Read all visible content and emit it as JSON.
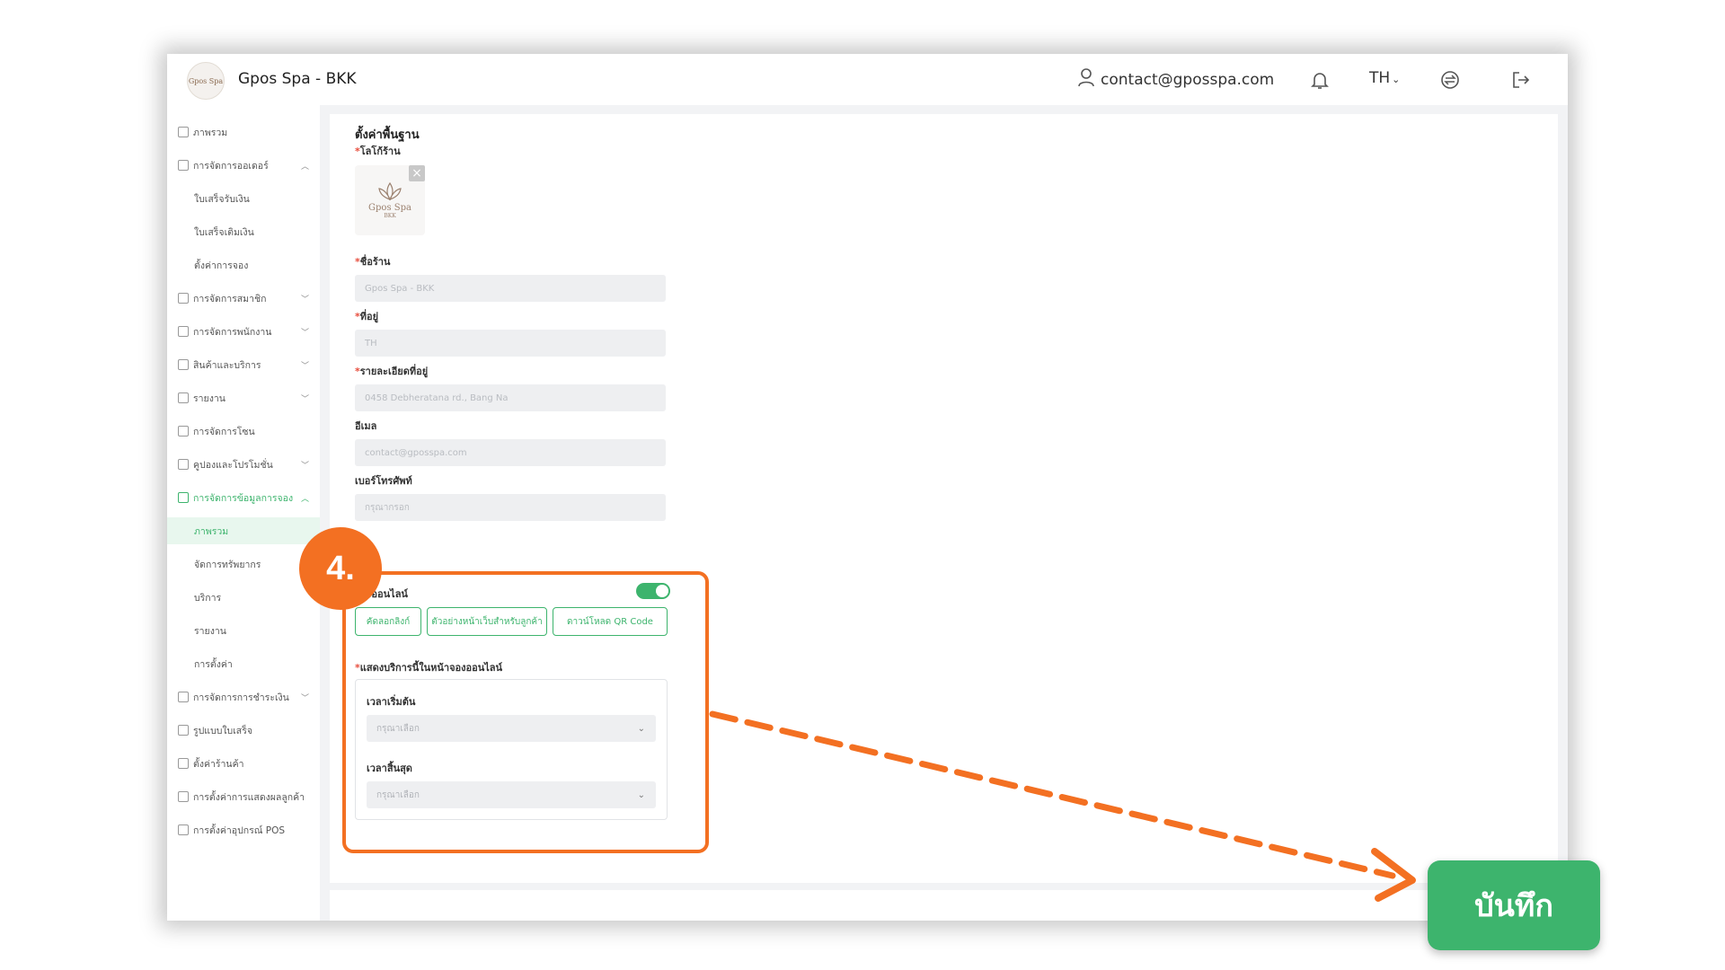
{
  "header": {
    "logo_text": "Gpos Spa",
    "brand": "Gpos Spa - BKK",
    "user_email": "contact@gposspa.com",
    "language": "TH",
    "icons": {
      "user": "user-icon",
      "bell": "bell-icon",
      "switch": "switch-icon",
      "logout": "logout-icon"
    }
  },
  "sidebar": {
    "items": [
      {
        "label": "ภาพรวม",
        "icon": "clipboard-icon",
        "chevron": ""
      },
      {
        "label": "การจัดการออเดอร์",
        "icon": "document-icon",
        "chevron": "up"
      },
      {
        "label": "ใบเสร็จรับเงิน",
        "sub": true
      },
      {
        "label": "ใบเสร็จเติมเงิน",
        "sub": true
      },
      {
        "label": "ตั้งค่าการจอง",
        "sub": true
      },
      {
        "label": "การจัดการสมาชิก",
        "icon": "crown-icon",
        "chevron": "down"
      },
      {
        "label": "การจัดการพนักงาน",
        "icon": "calendar-icon",
        "chevron": "down"
      },
      {
        "label": "สินค้าและบริการ",
        "icon": "product-icon",
        "chevron": "down"
      },
      {
        "label": "รายงาน",
        "icon": "report-icon",
        "chevron": "down"
      },
      {
        "label": "การจัดการโซน",
        "icon": "zone-icon",
        "chevron": ""
      },
      {
        "label": "คูปองและโปรโมชั่น",
        "icon": "gift-icon",
        "chevron": "down"
      },
      {
        "label": "การจัดการข้อมูลการจอง",
        "icon": "booking-icon",
        "chevron": "up",
        "active_parent": true
      },
      {
        "label": "ภาพรวม",
        "sub": true,
        "active": true
      },
      {
        "label": "จัดการทรัพยากร",
        "sub": true,
        "chevron": "down"
      },
      {
        "label": "บริการ",
        "sub": true
      },
      {
        "label": "รายงาน",
        "sub": true,
        "chevron": "down"
      },
      {
        "label": "การตั้งค่า",
        "sub": true,
        "chevron": "down"
      },
      {
        "label": "การจัดการการชำระเงิน",
        "icon": "payment-icon",
        "chevron": "down"
      },
      {
        "label": "รูปแบบใบเสร็จ",
        "icon": "receipt-icon",
        "chevron": ""
      },
      {
        "label": "ตั้งค่าร้านค้า",
        "icon": "store-icon",
        "chevron": ""
      },
      {
        "label": "การตั้งค่าการแสดงผลลูกค้า",
        "icon": "display-icon",
        "chevron": ""
      },
      {
        "label": "การตั้งค่าอุปกรณ์ POS",
        "icon": "pos-icon",
        "chevron": ""
      }
    ]
  },
  "form": {
    "section_title": "ตั้งค่าพื้นฐาน",
    "logo_label": "โลโก้ร้าน",
    "logo_text": "Gpos Spa",
    "logo_subtext": "BKK",
    "store_name_label": "ชื่อร้าน",
    "store_name_value": "Gpos Spa - BKK",
    "address_label": "ที่อยู่",
    "address_value": "TH",
    "address_detail_label": "รายละเอียดที่อยู่",
    "address_detail_value": "0458 Debheratana rd., Bang Na",
    "email_label": "อีเมล",
    "email_value": "contact@gposspa.com",
    "phone_label": "เบอร์โทรศัพท์",
    "phone_placeholder": "กรุณากรอก",
    "online_booking_label": "จองออนไลน์",
    "online_booking_on": true,
    "btn_copy_link": "คัดลอกลิงก์",
    "btn_preview": "ตัวอย่างหน้าเว็บสำหรับลูกค้า",
    "btn_download_qr": "ดาวน์โหลด QR Code",
    "show_services_label": "แสดงบริการนี้ในหน้าจองออนไลน์",
    "start_time_label": "เวลาเริ่มต้น",
    "start_time_placeholder": "กรุณาเลือก",
    "end_time_label": "เวลาสิ้นสุด",
    "end_time_placeholder": "กรุณาเลือก"
  },
  "annotation": {
    "step": "4.",
    "accent_color": "#f37022"
  },
  "save_button": "บันทึก",
  "colors": {
    "primary": "#3db46d",
    "accent": "#f37022"
  }
}
